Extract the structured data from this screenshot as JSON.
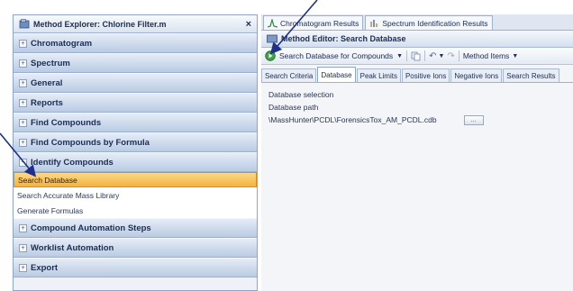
{
  "left_panel": {
    "title": "Method Explorer: Chlorine Filter.m",
    "close": "×",
    "sections_top": [
      "Chromatogram",
      "Spectrum",
      "General",
      "Reports",
      "Find Compounds",
      "Find Compounds by Formula",
      "Identify Compounds"
    ],
    "identify_items": [
      "Search Database",
      "Search Accurate Mass Library",
      "Generate Formulas"
    ],
    "sections_bottom": [
      "Compound Automation Steps",
      "Worklist Automation",
      "Export"
    ]
  },
  "doc_tabs": [
    "Chromatogram Results",
    "Spectrum Identification Results"
  ],
  "editor": {
    "title": "Method Editor: Search Database",
    "toolbar": {
      "run_label": "Search Database for Compounds",
      "method_items": "Method Items"
    },
    "tabs": [
      "Search Criteria",
      "Database",
      "Peak Limits",
      "Positive Ions",
      "Negative Ions",
      "Search Results"
    ],
    "content": {
      "section": "Database selection",
      "path_label": "Database path",
      "path_value": "\\MassHunter\\PCDL\\ForensicsTox_AM_PCDL.cdb",
      "browse": "..."
    }
  },
  "colors": {
    "accent_selected": "#f4b23c",
    "arrow": "#1f2f8c"
  }
}
